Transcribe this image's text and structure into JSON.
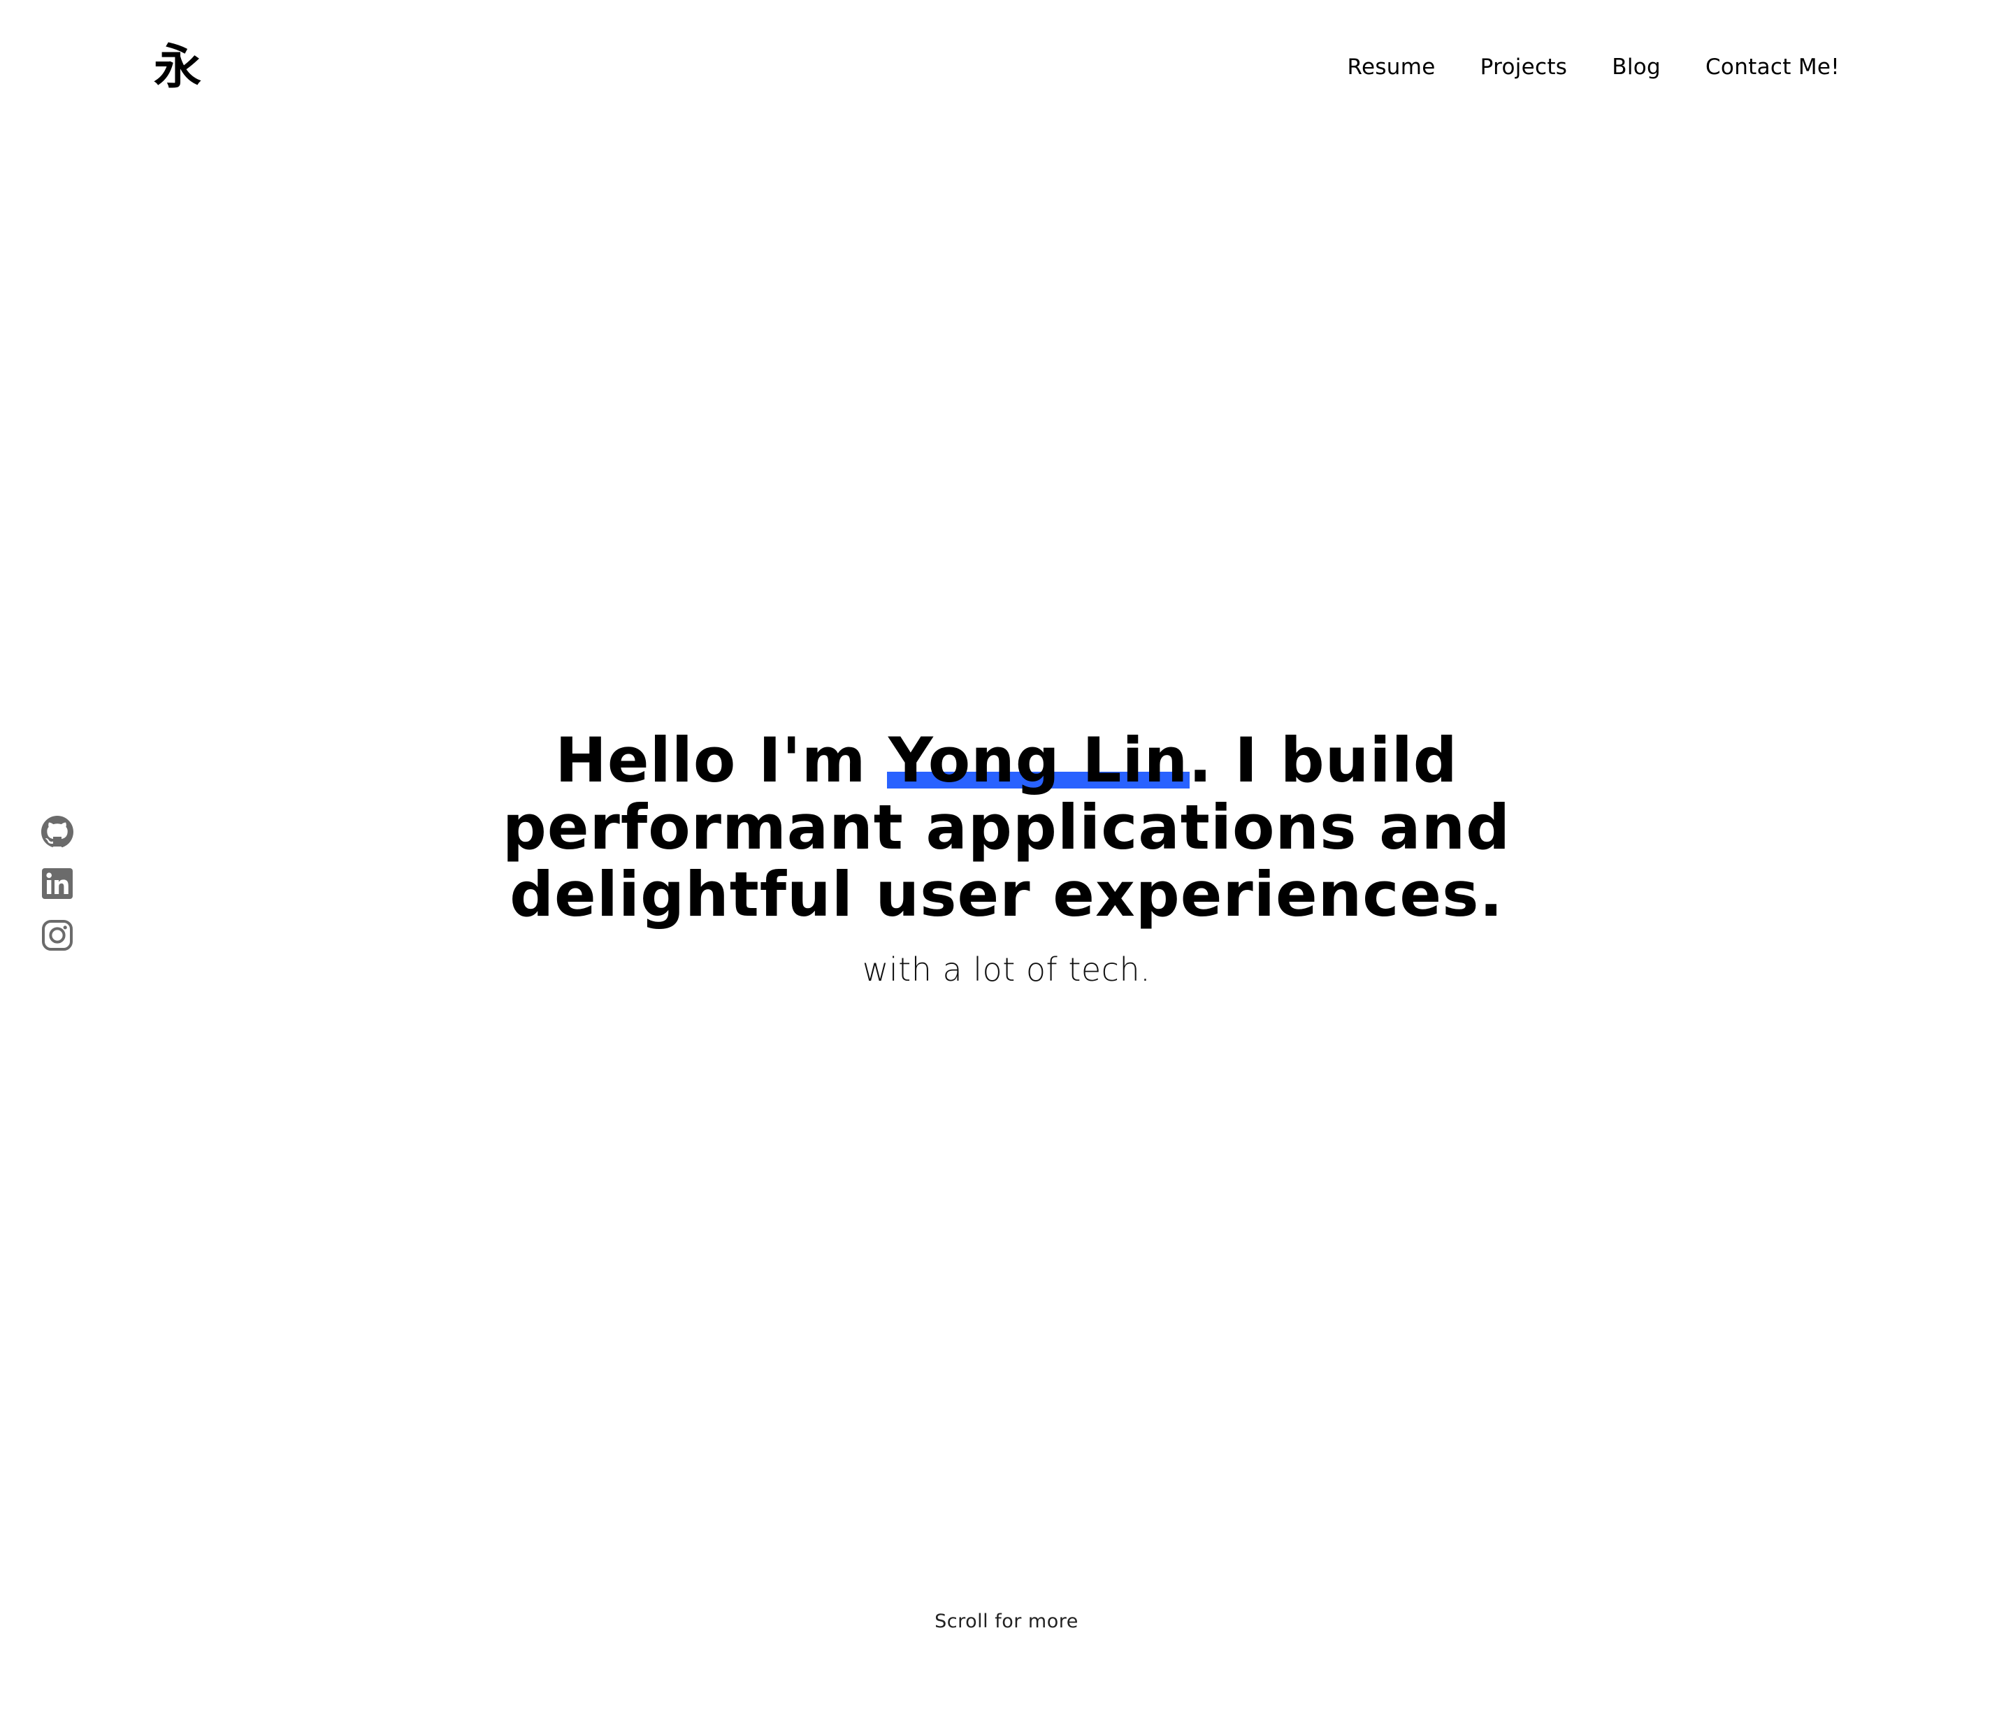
{
  "header": {
    "logo_text": "永",
    "nav": [
      {
        "label": "Resume"
      },
      {
        "label": "Projects"
      },
      {
        "label": "Blog"
      },
      {
        "label": "Contact Me!"
      }
    ]
  },
  "social": [
    {
      "icon": "github-icon"
    },
    {
      "icon": "linkedin-icon"
    },
    {
      "icon": "instagram-icon"
    }
  ],
  "hero": {
    "prefix": "Hello I'm ",
    "name": "Yong Lin",
    "suffix": ". I build performant applications and delightful user experiences.",
    "subline": "with a lot of tech."
  },
  "footer": {
    "scroll_hint": "Scroll for more"
  },
  "colors": {
    "accent": "#2962ff",
    "icon_gray": "#6b6b6b",
    "text": "#000000",
    "background": "#ffffff"
  }
}
